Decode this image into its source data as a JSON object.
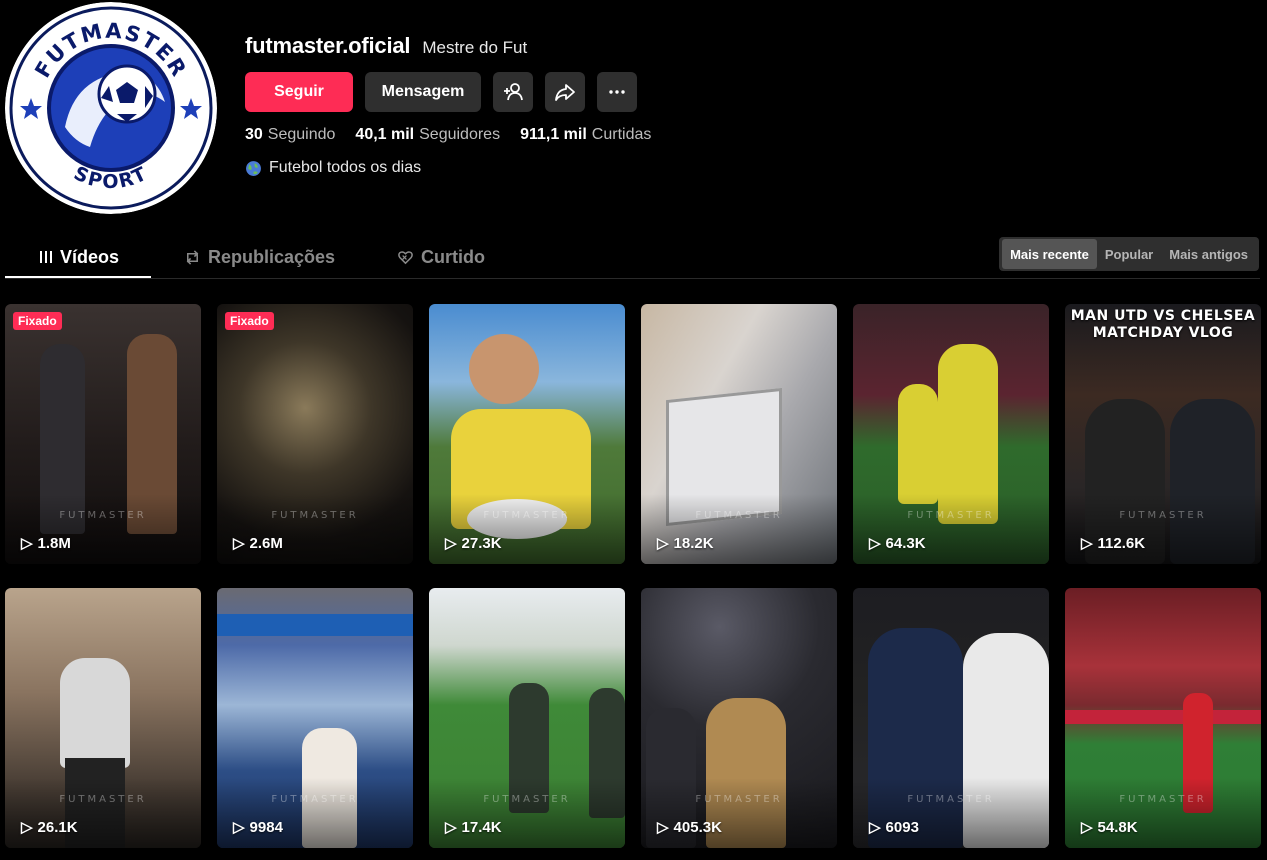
{
  "profile": {
    "username": "futmaster.oficial",
    "nickname": "Mestre do Fut",
    "avatar_text_top": "FUTMASTER",
    "avatar_text_bottom": "SPORT",
    "follow_label": "Seguir",
    "message_label": "Mensagem",
    "stats": [
      {
        "number": "30",
        "label": "Seguindo"
      },
      {
        "number": "40,1 mil",
        "label": "Seguidores"
      },
      {
        "number": "911,1 mil",
        "label": "Curtidas"
      }
    ],
    "bio": "Futebol todos os dias"
  },
  "tabs": [
    {
      "label": "Vídeos",
      "icon": "grid-icon",
      "active": true
    },
    {
      "label": "Republicações",
      "icon": "repost-icon",
      "active": false
    },
    {
      "label": "Curtido",
      "icon": "heart-icon",
      "active": false
    }
  ],
  "sort_options": [
    {
      "label": "Mais recente",
      "active": true
    },
    {
      "label": "Popular",
      "active": false
    },
    {
      "label": "Mais antigos",
      "active": false
    }
  ],
  "watermark": "FUTMASTER",
  "videos": [
    {
      "views": "1.8M",
      "badge": "Fixado"
    },
    {
      "views": "2.6M",
      "badge": "Fixado"
    },
    {
      "views": "27.3K"
    },
    {
      "views": "18.2K"
    },
    {
      "views": "64.3K"
    },
    {
      "views": "112.6K",
      "overlay": "MAN UTD VS CHELSEA MATCHDAY VLOG"
    },
    {
      "views": "26.1K"
    },
    {
      "views": "9984"
    },
    {
      "views": "17.4K"
    },
    {
      "views": "405.3K"
    },
    {
      "views": "6093"
    },
    {
      "views": "54.8K"
    }
  ],
  "colors": {
    "accent": "#fe2c55",
    "button_dark": "#2f2f2f",
    "background": "#000000"
  }
}
